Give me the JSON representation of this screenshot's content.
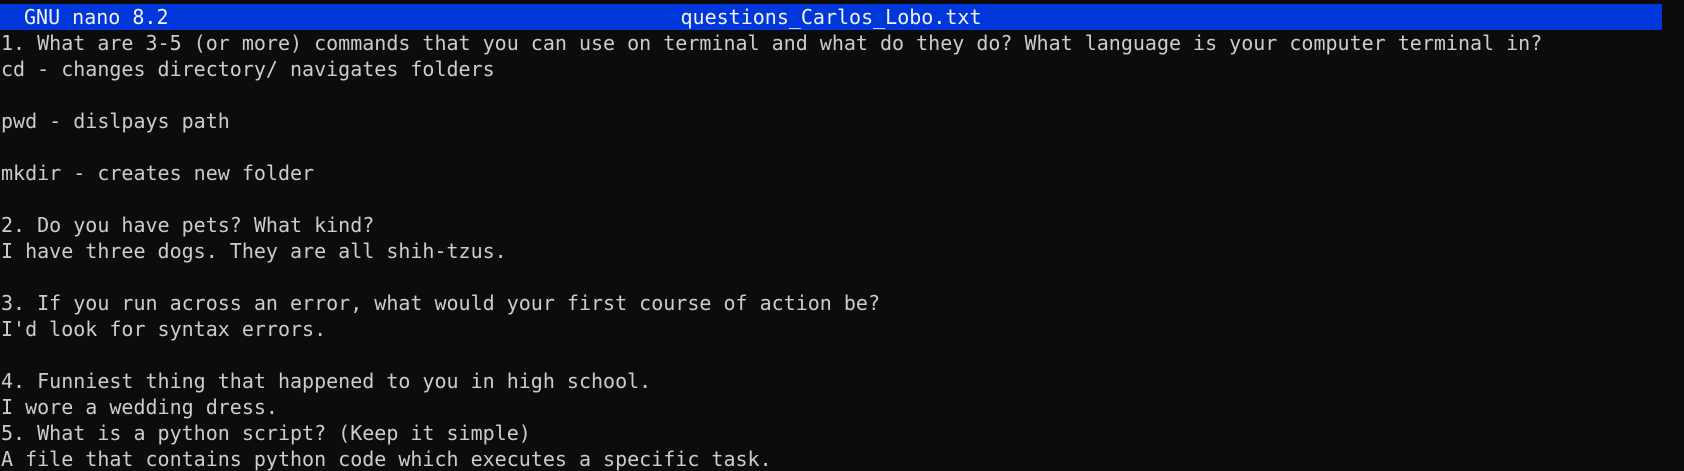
{
  "header": {
    "app_name": "GNU nano 8.2",
    "file_name": "questions_Carlos_Lobo.txt"
  },
  "colors": {
    "background": "#0c0c0c",
    "text": "#cccccc",
    "titlebar": "#0037da",
    "titlebar_text": "#f2f2f2"
  },
  "lines": [
    "1. What are 3-5 (or more) commands that you can use on terminal and what do they do? What language is your computer terminal in?",
    "cd - changes directory/ navigates folders",
    "",
    "pwd - dislpays path",
    "",
    "mkdir - creates new folder",
    "",
    "2. Do you have pets? What kind?",
    "I have three dogs. They are all shih-tzus.",
    "",
    "3. If you run across an error, what would your first course of action be?",
    "I'd look for syntax errors.",
    "",
    "4. Funniest thing that happened to you in high school.",
    "I wore a wedding dress.",
    "5. What is a python script? (Keep it simple)",
    "A file that contains python code which executes a specific task."
  ]
}
